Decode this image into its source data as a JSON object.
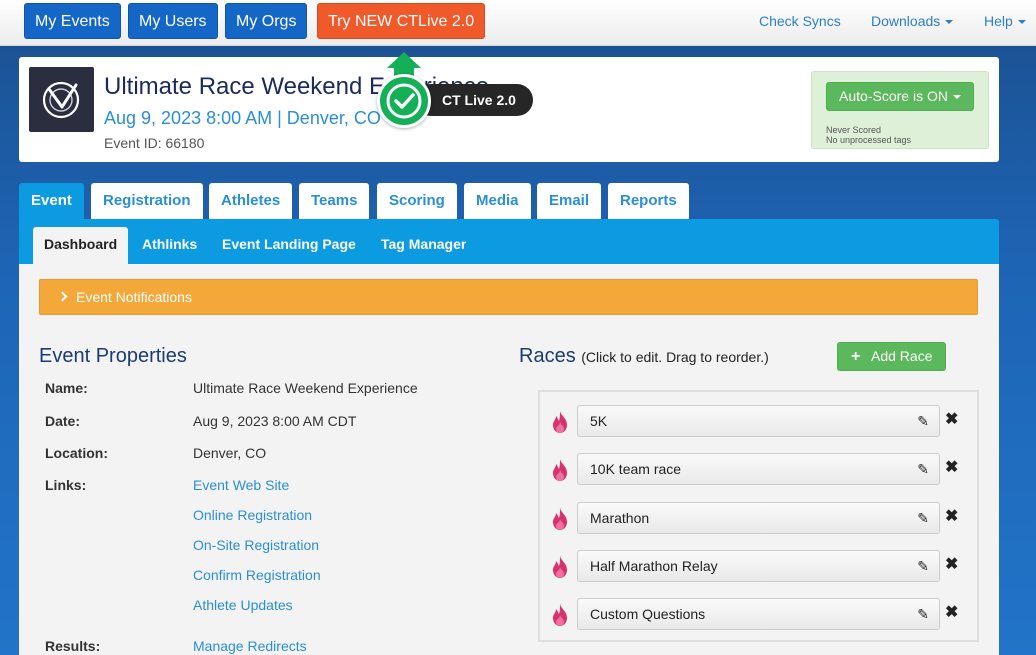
{
  "nav": {
    "my_events": "My Events",
    "my_users": "My Users",
    "my_orgs": "My Orgs",
    "try_new": "Try NEW CTLive 2.0",
    "check_syncs": "Check Syncs",
    "downloads": "Downloads",
    "help": "Help"
  },
  "event": {
    "title": "Ultimate Race Weekend Experience",
    "date_location": "Aug 9, 2023 8:00 AM | Denver, CO",
    "event_id": "Event ID: 66180"
  },
  "ctlive_badge": "CT Live 2.0",
  "autoscore": {
    "button": "Auto-Score is ON",
    "line1": "Never Scored",
    "line2": "No unprocessed tags"
  },
  "tabs": [
    "Event",
    "Registration",
    "Athletes",
    "Teams",
    "Scoring",
    "Media",
    "Email",
    "Reports"
  ],
  "subtabs": [
    "Dashboard",
    "Athlinks",
    "Event Landing Page",
    "Tag Manager"
  ],
  "notifications": "Event Notifications",
  "properties": {
    "title": "Event Properties",
    "name_label": "Name:",
    "name_value": "Ultimate Race Weekend Experience",
    "date_label": "Date:",
    "date_value": "Aug 9, 2023 8:00 AM CDT",
    "location_label": "Location:",
    "location_value": "Denver, CO",
    "links_label": "Links:",
    "links": [
      "Event Web Site",
      "Online Registration",
      "On-Site Registration",
      "Confirm Registration",
      "Athlete Updates"
    ],
    "results_label": "Results:",
    "results_link": "Manage Redirects"
  },
  "races": {
    "title": "Races",
    "subtitle": "(Click to edit. Drag to reorder.)",
    "add_button": "Add Race",
    "items": [
      "5K",
      "10K team race",
      "Marathon",
      "Half Marathon Relay",
      "Custom Questions"
    ]
  },
  "colors": {
    "nav_blue": "#1466c7",
    "nav_orange": "#f0592a",
    "tab_blue": "#0c9be0",
    "link_blue": "#2a8fd3",
    "success_green": "#5cb85c",
    "warning_orange": "#f5a83a",
    "fire_pink": "#d6336c"
  }
}
